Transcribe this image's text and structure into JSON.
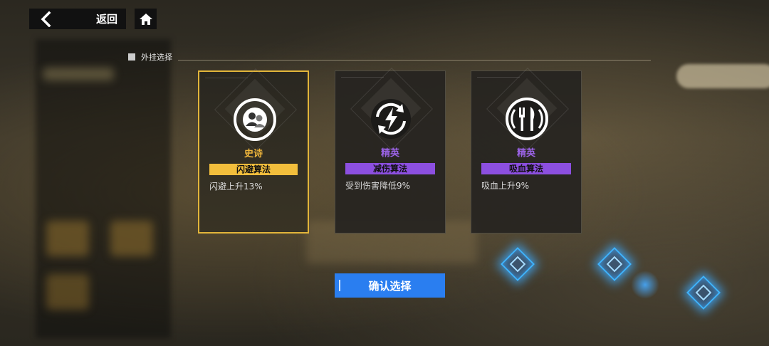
{
  "top_bar": {
    "back_label": "返回",
    "back_icon": "chevron-left-icon",
    "home_icon": "home-icon"
  },
  "section": {
    "title": "外挂选择"
  },
  "cards": [
    {
      "rarity": "史诗",
      "rarity_color": "#f0b73c",
      "name": "闪避算法",
      "name_bg": "#f2be3c",
      "description": "闪避上升13%",
      "icon": "users-icon",
      "selected": true
    },
    {
      "rarity": "精英",
      "rarity_color": "#9b63e6",
      "name": "减伤算法",
      "name_bg": "#8c4fe0",
      "description": "受到伤害降低9%",
      "icon": "lightning-cycle-icon",
      "selected": false
    },
    {
      "rarity": "精英",
      "rarity_color": "#9b63e6",
      "name": "吸血算法",
      "name_bg": "#8c4fe0",
      "description": "吸血上升9%",
      "icon": "fork-knife-icon",
      "selected": false
    }
  ],
  "confirm": {
    "label": "确认选择",
    "color": "#2a7ef0"
  }
}
